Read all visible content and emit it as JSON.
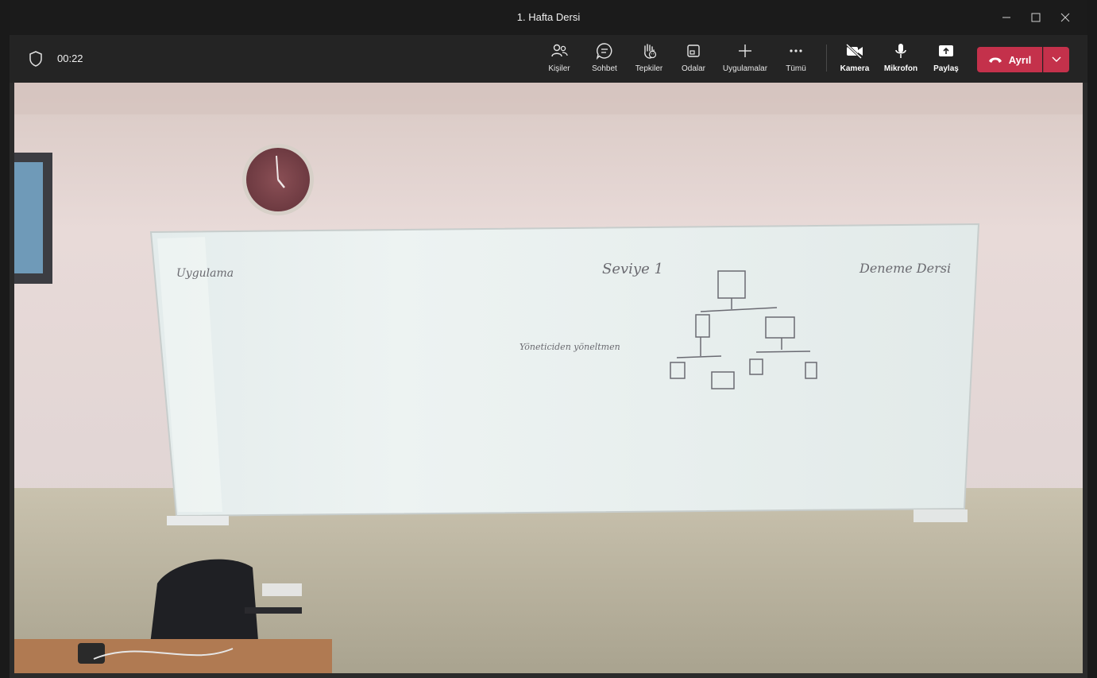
{
  "window": {
    "title": "1. Hafta Dersi",
    "controls": [
      "minimize-icon",
      "maximize-icon",
      "close-icon"
    ]
  },
  "meeting": {
    "timer": "00:22"
  },
  "toolbar": {
    "people_label": "Kişiler",
    "chat_label": "Sohbet",
    "reactions_label": "Tepkiler",
    "rooms_label": "Odalar",
    "apps_label": "Uygulamalar",
    "more_label": "Tümü",
    "camera_label": "Kamera",
    "mic_label": "Mikrofon",
    "share_label": "Paylaş",
    "leave_label": "Ayrıl"
  },
  "whiteboard": {
    "text_left": "Uygulama",
    "text_center": "Seviye 1",
    "text_right": "Deneme Dersi",
    "text_side": "Yöneticiden yöneltmen"
  },
  "colors": {
    "leave_button": "#c4314b",
    "titlebar": "#1b1b1b",
    "toolbar": "#242424"
  }
}
